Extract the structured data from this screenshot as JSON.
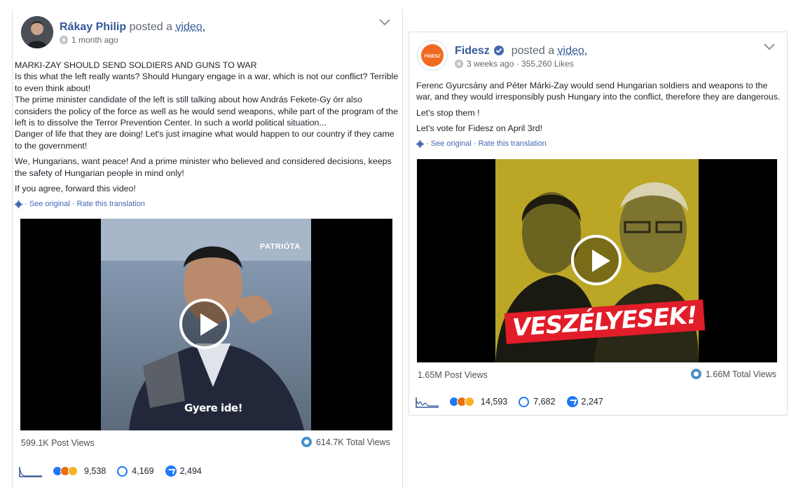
{
  "post1": {
    "author": "Rákay Philip",
    "action_prefix": "posted a",
    "action_link": "video.",
    "time": "1 month ago",
    "paragraphs": [
      "MARKI-ZAY SHOULD SEND SOLDIERS AND GUNS TO WAR\nIs this what the left really wants? Should Hungary engage in a war, which is not our conflict? Terrible to even think about!\nThe prime minister candidate of the left is still talking about how András Fekete-Gy órr also considers the policy of the force as well as he would send weapons, while part of the program of the left is to dissolve the Terror Prevention Center. In such a world political situation...\nDanger of life that they are doing! Let's just imagine what would happen to our country if they came to the government!",
      "We, Hungarians, want peace! And a prime minister who believed and considered decisions, keeps the safety of Hungarian people in mind only!",
      "If you agree, forward this video!"
    ],
    "translation": "· See original · Rate this translation",
    "video": {
      "watermark": "PATRIÓTA",
      "caption": "Gyere ide!"
    },
    "post_views": "599.1K Post Views",
    "total_views": "614.7K Total Views",
    "reactions": "9,538",
    "comments": "4,169",
    "shares": "2,494"
  },
  "post2": {
    "author": "Fidesz",
    "verified": true,
    "action_prefix": "posted a",
    "action_link": "video.",
    "time": "3 weeks ago · 355,260 Likes",
    "logo_text": "FIDESZ",
    "paragraphs": [
      "Ferenc Gyurcsány and Péter Márki-Zay would send Hungarian soldiers and weapons to the war, and they would irresponsibly push Hungary into the conflict, therefore they are dangerous.",
      "Let's stop them !",
      "Let's vote for Fidesz on April 3rd!"
    ],
    "translation": "· See original · Rate this translation",
    "video": {
      "banner": "VESZÉLYESEK!"
    },
    "post_views": "1.65M Post Views",
    "total_views": "1.66M Total Views",
    "reactions": "14,593",
    "comments": "7,682",
    "shares": "2,247"
  },
  "colors": {
    "link": "#365899",
    "accent": "#2078f4",
    "fidesz_orange": "#f26a21",
    "banner_red": "#e11d2a"
  }
}
